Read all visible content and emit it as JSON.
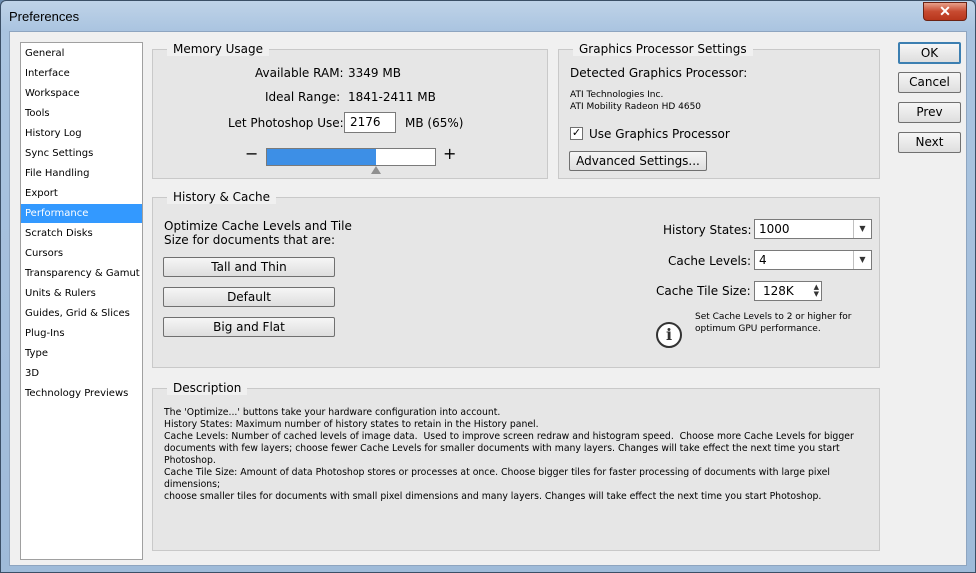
{
  "window": {
    "title": "Preferences",
    "close_icon": "✕"
  },
  "sidebar": {
    "items": [
      {
        "label": "General"
      },
      {
        "label": "Interface"
      },
      {
        "label": "Workspace"
      },
      {
        "label": "Tools"
      },
      {
        "label": "History Log"
      },
      {
        "label": "Sync Settings"
      },
      {
        "label": "File Handling"
      },
      {
        "label": "Export"
      },
      {
        "label": "Performance",
        "selected": true
      },
      {
        "label": "Scratch Disks"
      },
      {
        "label": "Cursors"
      },
      {
        "label": "Transparency & Gamut"
      },
      {
        "label": "Units & Rulers"
      },
      {
        "label": "Guides, Grid & Slices"
      },
      {
        "label": "Plug-Ins"
      },
      {
        "label": "Type"
      },
      {
        "label": "3D"
      },
      {
        "label": "Technology Previews"
      }
    ]
  },
  "memory": {
    "title": "Memory Usage",
    "available_label": "Available RAM:",
    "available_value": "3349 MB",
    "ideal_label": "Ideal Range:",
    "ideal_value": "1841-2411 MB",
    "use_label": "Let Photoshop Use:",
    "use_value": "2176",
    "use_suffix": "MB (65%)",
    "slider_level": 0.65,
    "minus": "−",
    "plus": "+"
  },
  "gpu": {
    "title": "Graphics Processor Settings",
    "detected_label": "Detected Graphics Processor:",
    "vendor": "ATI Technologies Inc.",
    "model": "ATI Mobility Radeon HD 4650",
    "use_gpu_label": "Use Graphics Processor",
    "use_gpu_checked": true,
    "check_glyph": "✓",
    "advanced_button": "Advanced Settings..."
  },
  "cache": {
    "title": "History & Cache",
    "optimize_line1": "Optimize Cache Levels and Tile",
    "optimize_line2": "Size for documents that are:",
    "btn_tall": "Tall and Thin",
    "btn_default": "Default",
    "btn_big": "Big and Flat",
    "history_label": "History States:",
    "history_value": "1000",
    "levels_label": "Cache Levels:",
    "levels_value": "4",
    "tile_label": "Cache Tile Size:",
    "tile_value": "128K",
    "hint_line1": "Set Cache Levels to 2 or higher for",
    "hint_line2": "optimum GPU performance.",
    "info_glyph": "i",
    "dropdown_glyph": "▼",
    "spin_glyph_up": "▲",
    "spin_glyph_down": "▼"
  },
  "description": {
    "title": "Description",
    "text": "The 'Optimize...' buttons take your hardware configuration into account.\nHistory States: Maximum number of history states to retain in the History panel.\nCache Levels: Number of cached levels of image data.  Used to improve screen redraw and histogram speed.  Choose more Cache Levels for bigger\ndocuments with few layers; choose fewer Cache Levels for smaller documents with many layers. Changes will take effect the next time you start\nPhotoshop.\nCache Tile Size: Amount of data Photoshop stores or processes at once. Choose bigger tiles for faster processing of documents with large pixel dimensions;\nchoose smaller tiles for documents with small pixel dimensions and many layers. Changes will take effect the next time you start Photoshop."
  },
  "actions": {
    "ok": "OK",
    "cancel": "Cancel",
    "prev": "Prev",
    "next": "Next"
  }
}
